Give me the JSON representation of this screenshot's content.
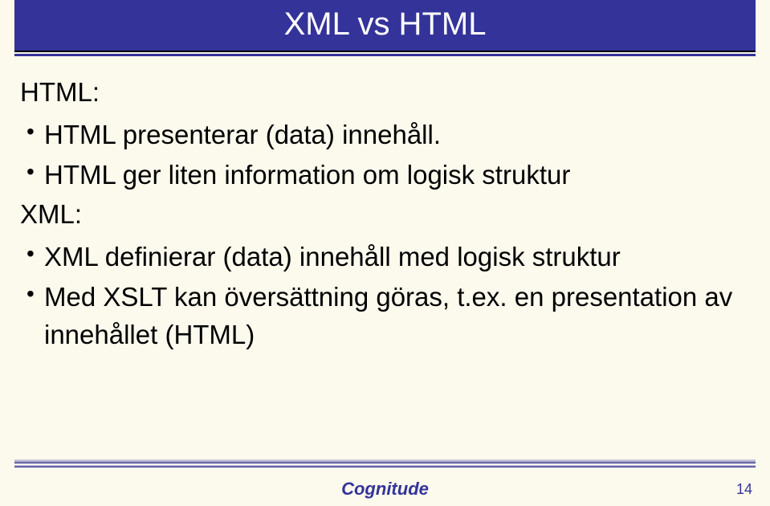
{
  "title": "XML vs HTML",
  "sections": [
    {
      "label": "HTML:",
      "items": [
        "HTML presenterar (data) innehåll.",
        "HTML ger liten information om logisk struktur"
      ]
    },
    {
      "label": "XML:",
      "items": [
        "XML definierar (data) innehåll med logisk struktur",
        "Med XSLT kan översättning göras, t.ex. en presentation av innehållet (HTML)"
      ]
    }
  ],
  "footer": {
    "brand": "Cognitude",
    "page": "14"
  }
}
